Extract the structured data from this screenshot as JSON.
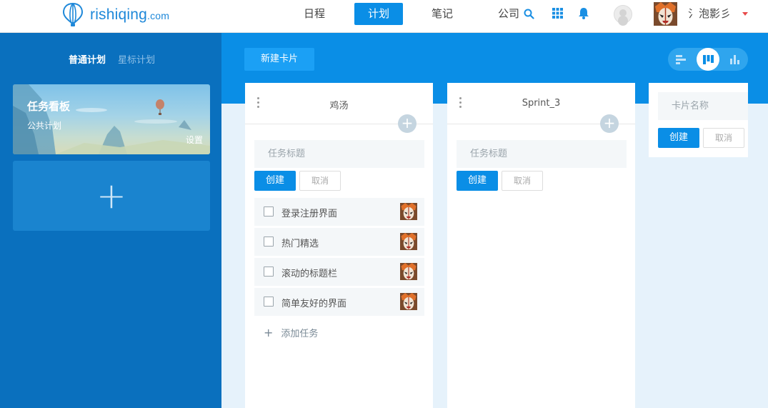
{
  "brand": {
    "name": "rishiqing",
    "suffix": ".com"
  },
  "nav": {
    "items": [
      {
        "label": "日程",
        "active": false
      },
      {
        "label": "计划",
        "active": true
      },
      {
        "label": "笔记",
        "active": false
      }
    ],
    "company_label": "公司",
    "username": "氵泡影彡"
  },
  "sidebar": {
    "tabs": [
      {
        "label": "普通计划",
        "active": true
      },
      {
        "label": "星标计划",
        "active": false
      }
    ],
    "board": {
      "title": "任务看板",
      "subtitle": "公共计划",
      "settings_label": "设置"
    },
    "add_board_symbol": "+"
  },
  "toolbar": {
    "new_card_label": "新建卡片"
  },
  "columns": [
    {
      "title": "鸡汤",
      "task_placeholder": "任务标题",
      "create_label": "创建",
      "cancel_label": "取消",
      "tasks": [
        {
          "name": "登录注册界面"
        },
        {
          "name": "热门精选"
        },
        {
          "name": "滚动的标题栏"
        },
        {
          "name": "简单友好的界面"
        }
      ],
      "add_task_label": "添加任务"
    },
    {
      "title": "Sprint_3",
      "task_placeholder": "任务标题",
      "create_label": "创建",
      "cancel_label": "取消",
      "tasks": []
    }
  ],
  "new_card_form": {
    "placeholder": "卡片名称",
    "create_label": "创建",
    "cancel_label": "取消"
  },
  "colors": {
    "accent": "#0a8ee6",
    "sidebar": "#0a70be",
    "brand": "#1e88d9"
  }
}
